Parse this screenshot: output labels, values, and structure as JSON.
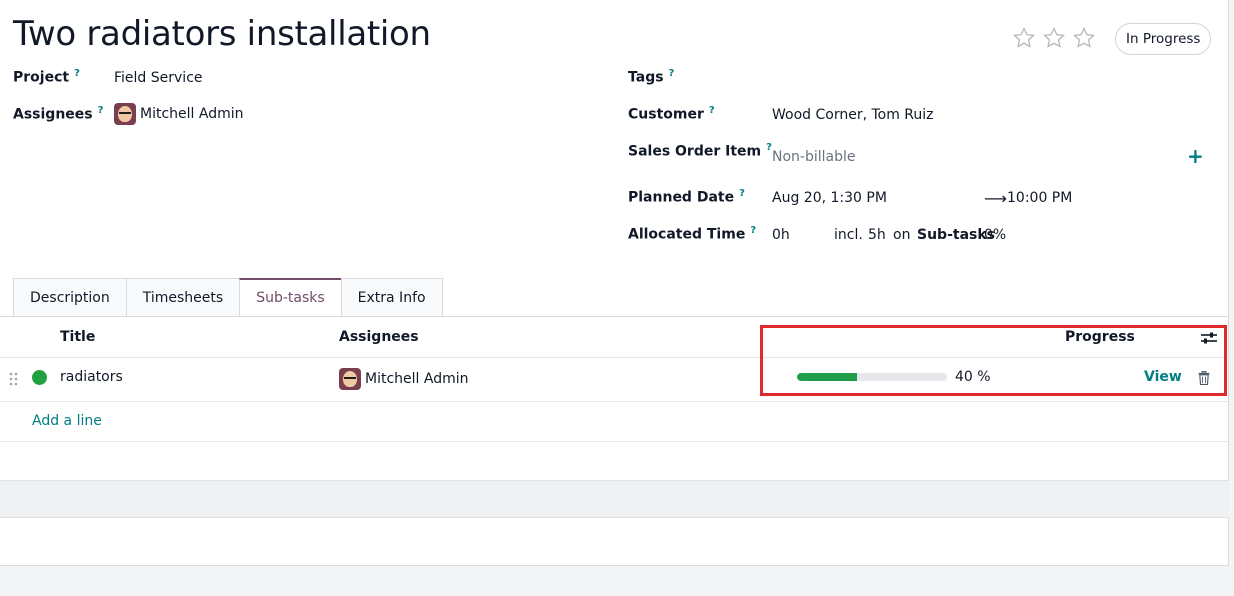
{
  "task": {
    "title": "Two radiators installation",
    "stage": "In Progress"
  },
  "fields_left": {
    "project_label": "Project",
    "project_value": "Field Service",
    "assignees_label": "Assignees",
    "assignees_value": "Mitchell Admin"
  },
  "fields_right": {
    "tags_label": "Tags",
    "customer_label": "Customer",
    "customer_value": "Wood Corner, Tom Ruiz",
    "sale_line_label": "Sales Order Item",
    "sale_line_placeholder": "Non-billable",
    "planned_date_label": "Planned Date",
    "planned_start": "Aug 20, 1:30 PM",
    "planned_end": "10:00 PM",
    "allocated_label": "Allocated Time",
    "allocated_value": "0h",
    "incl_text": "incl.",
    "subtask_hours": "5h",
    "on_text": "on",
    "subtasks_text": "Sub-tasks",
    "allocated_progress": "0%"
  },
  "help_mark": "?",
  "tabs": [
    {
      "label": "Description",
      "active": false
    },
    {
      "label": "Timesheets",
      "active": false
    },
    {
      "label": "Sub-tasks",
      "active": true
    },
    {
      "label": "Extra Info",
      "active": false
    }
  ],
  "subtasks_table": {
    "columns": {
      "title": "Title",
      "assignees": "Assignees",
      "progress": "Progress"
    },
    "rows": [
      {
        "title": "radiators",
        "assignee": "Mitchell Admin",
        "progress": 40,
        "progress_text": "40 %",
        "action": "View",
        "state_color": "#21a142"
      }
    ],
    "add_line": "Add a line"
  },
  "colors": {
    "accent": "#017e84",
    "brand": "#714b67",
    "progress": "#1e9e4a",
    "highlight": "#e0282d"
  }
}
